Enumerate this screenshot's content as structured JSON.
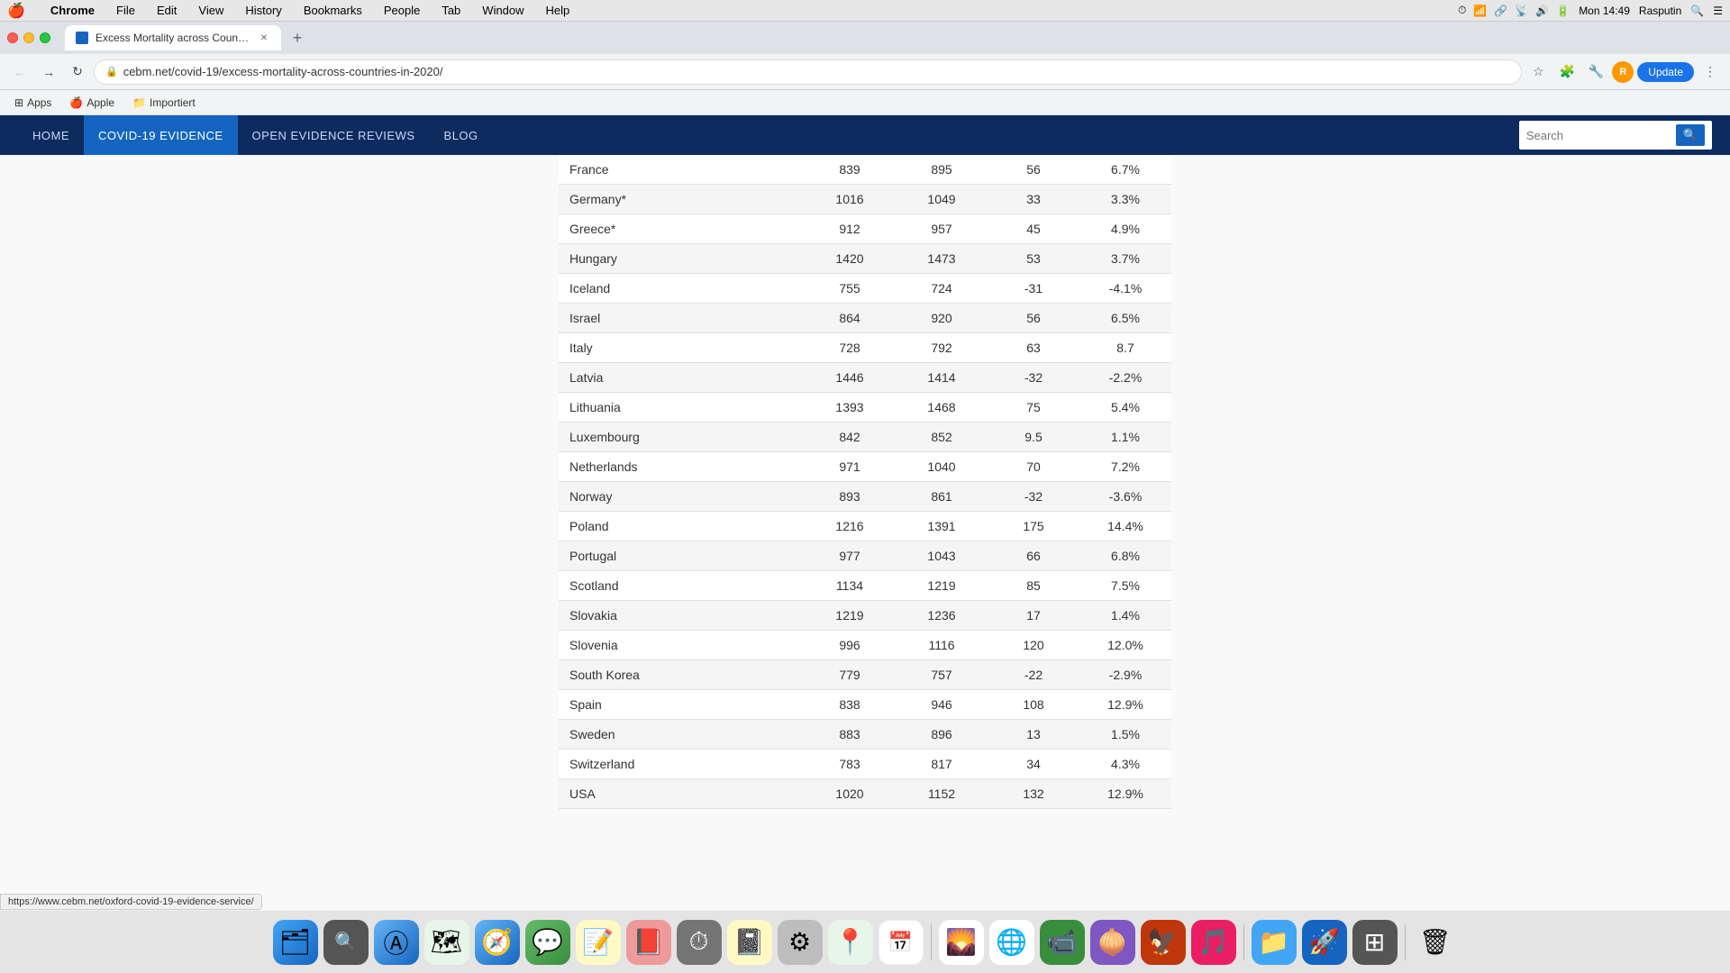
{
  "menubar": {
    "apple": "🍎",
    "items": [
      "Chrome",
      "File",
      "Edit",
      "View",
      "History",
      "Bookmarks",
      "People",
      "Tab",
      "Window",
      "Help"
    ],
    "chrome_bold": "Chrome",
    "time": "Mon 14:49",
    "username": "Rasputin"
  },
  "titlebar": {
    "tab_title": "Excess Mortality across Count…",
    "new_tab_label": "+"
  },
  "toolbar": {
    "url": "cebm.net/covid-19/excess-mortality-across-countries-in-2020/",
    "back_label": "←",
    "forward_label": "→",
    "reload_label": "↻",
    "update_label": "Update"
  },
  "bookmarks": {
    "apps_label": "Apps",
    "apple_label": "Apple",
    "importiert_label": "Importiert"
  },
  "site_nav": {
    "links": [
      "HOME",
      "COVID-19 EVIDENCE",
      "OPEN EVIDENCE REVIEWS",
      "BLOG"
    ],
    "active_index": 1,
    "search_placeholder": "Search"
  },
  "table": {
    "rows": [
      {
        "country": "France",
        "col1": "839",
        "col2": "895",
        "col3": "56",
        "col4": "6.7%"
      },
      {
        "country": "Germany*",
        "col1": "1016",
        "col2": "1049",
        "col3": "33",
        "col4": "3.3%"
      },
      {
        "country": "Greece*",
        "col1": "912",
        "col2": "957",
        "col3": "45",
        "col4": "4.9%"
      },
      {
        "country": "Hungary",
        "col1": "1420",
        "col2": "1473",
        "col3": "53",
        "col4": "3.7%"
      },
      {
        "country": "Iceland",
        "col1": "755",
        "col2": "724",
        "col3": "-31",
        "col4": "-4.1%"
      },
      {
        "country": "Israel",
        "col1": "864",
        "col2": "920",
        "col3": "56",
        "col4": "6.5%"
      },
      {
        "country": "Italy",
        "col1": "728",
        "col2": "792",
        "col3": "63",
        "col4": "8.7"
      },
      {
        "country": "Latvia",
        "col1": "1446",
        "col2": "1414",
        "col3": "-32",
        "col4": "-2.2%"
      },
      {
        "country": "Lithuania",
        "col1": "1393",
        "col2": "1468",
        "col3": "75",
        "col4": "5.4%"
      },
      {
        "country": "Luxembourg",
        "col1": "842",
        "col2": "852",
        "col3": "9.5",
        "col4": "1.1%"
      },
      {
        "country": "Netherlands",
        "col1": "971",
        "col2": "1040",
        "col3": "70",
        "col4": "7.2%"
      },
      {
        "country": "Norway",
        "col1": "893",
        "col2": "861",
        "col3": "-32",
        "col4": "-3.6%"
      },
      {
        "country": "Poland",
        "col1": "1216",
        "col2": "1391",
        "col3": "175",
        "col4": "14.4%"
      },
      {
        "country": "Portugal",
        "col1": "977",
        "col2": "1043",
        "col3": "66",
        "col4": "6.8%"
      },
      {
        "country": "Scotland",
        "col1": "1134",
        "col2": "1219",
        "col3": "85",
        "col4": "7.5%"
      },
      {
        "country": "Slovakia",
        "col1": "1219",
        "col2": "1236",
        "col3": "17",
        "col4": "1.4%"
      },
      {
        "country": "Slovenia",
        "col1": "996",
        "col2": "1116",
        "col3": "120",
        "col4": "12.0%"
      },
      {
        "country": "South Korea",
        "col1": "779",
        "col2": "757",
        "col3": "-22",
        "col4": "-2.9%"
      },
      {
        "country": "Spain",
        "col1": "838",
        "col2": "946",
        "col3": "108",
        "col4": "12.9%"
      },
      {
        "country": "Sweden",
        "col1": "883",
        "col2": "896",
        "col3": "13",
        "col4": "1.5%"
      },
      {
        "country": "Switzerland",
        "col1": "783",
        "col2": "817",
        "col3": "34",
        "col4": "4.3%"
      },
      {
        "country": "USA",
        "col1": "1020",
        "col2": "1152",
        "col3": "132",
        "col4": "12.9%"
      }
    ]
  },
  "status_bar": {
    "link": "https://www.cebm.net/oxford-covid-19-evidence-service/"
  },
  "dock": {
    "icons": [
      {
        "name": "finder",
        "symbol": "🗂",
        "color": "#1e88e5"
      },
      {
        "name": "spotlight",
        "symbol": "🔍",
        "color": "#333"
      },
      {
        "name": "app-store",
        "symbol": "🅰",
        "color": "#1e88e5"
      },
      {
        "name": "maps",
        "symbol": "🗺",
        "color": "#4caf50"
      },
      {
        "name": "safari",
        "symbol": "🧭",
        "color": "#1e88e5"
      },
      {
        "name": "messages",
        "symbol": "💬",
        "color": "#4caf50"
      },
      {
        "name": "stickies",
        "symbol": "📝",
        "color": "#ffeb3b"
      },
      {
        "name": "pdf-reader",
        "symbol": "📕",
        "color": "#f44336"
      },
      {
        "name": "time-machine",
        "symbol": "⏱",
        "color": "#424242"
      },
      {
        "name": "notes",
        "symbol": "📓",
        "color": "#fff9c4"
      },
      {
        "name": "system-prefs",
        "symbol": "⚙",
        "color": "#757575"
      },
      {
        "name": "maps2",
        "symbol": "📍",
        "color": "#f44336"
      },
      {
        "name": "calendar",
        "symbol": "📅",
        "color": "#f44336"
      },
      {
        "name": "photos",
        "symbol": "🌄",
        "color": "#ff9800"
      },
      {
        "name": "chrome",
        "symbol": "🌐",
        "color": "#4caf50"
      },
      {
        "name": "facetime",
        "symbol": "📹",
        "color": "#4caf50"
      },
      {
        "name": "tor",
        "symbol": "🧅",
        "color": "#7e57c2"
      },
      {
        "name": "unknown1",
        "symbol": "🦅",
        "color": "#d84315"
      },
      {
        "name": "music",
        "symbol": "🎵",
        "color": "#f06292"
      },
      {
        "name": "finder2",
        "symbol": "📁",
        "color": "#42a5f5"
      },
      {
        "name": "launchpad",
        "symbol": "🚀",
        "color": "#1565c0"
      },
      {
        "name": "window-mgr",
        "symbol": "⊞",
        "color": "#555"
      },
      {
        "name": "trash",
        "symbol": "🗑",
        "color": "#757575"
      }
    ]
  }
}
